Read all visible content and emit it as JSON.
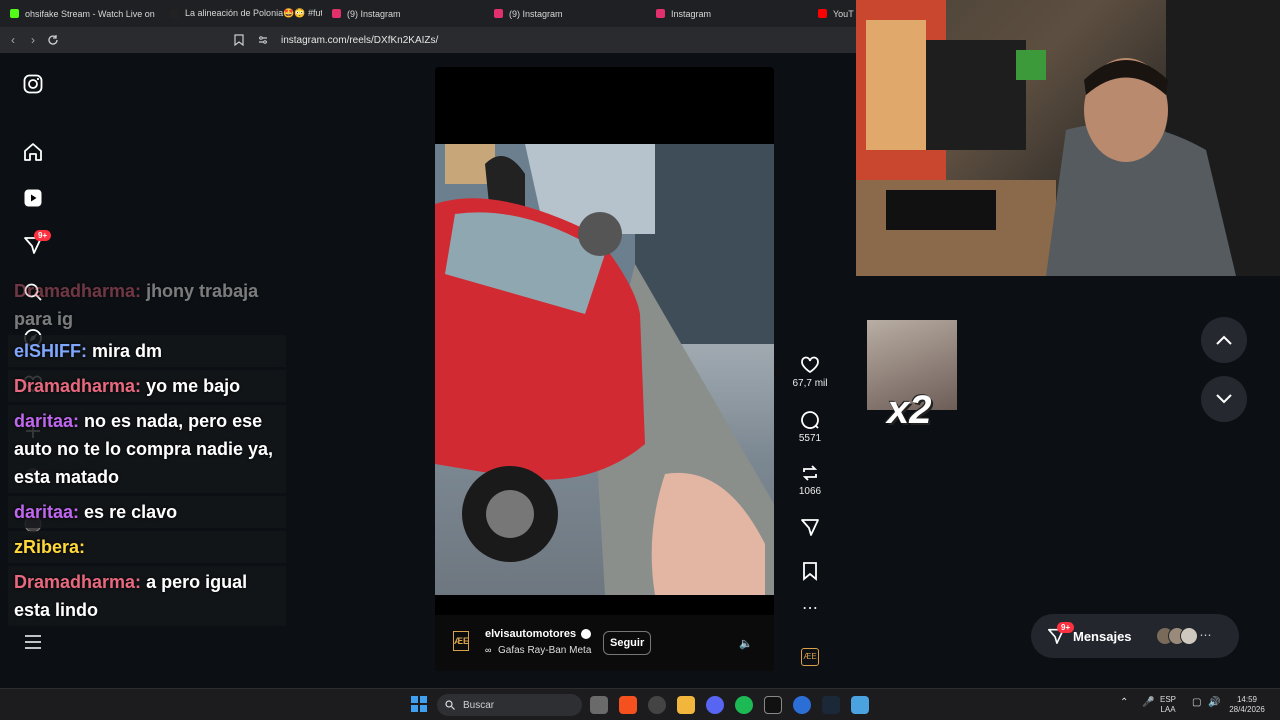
{
  "browser": {
    "tabs": [
      {
        "title": "ohsifake Stream - Watch Live on",
        "color": "#53fc18"
      },
      {
        "title": "La alineación de Polonia🤩😳 #futb",
        "color": "#222222"
      },
      {
        "title": "(9) Instagram",
        "color": "#e1306c"
      },
      {
        "title": "(9) Instagram",
        "color": "#e1306c"
      },
      {
        "title": "Instagram",
        "color": "#e1306c"
      },
      {
        "title": "YouT",
        "color": "#ff0000"
      }
    ],
    "url": "instagram.com/reels/DXfKn2KAIZs/"
  },
  "ig_sidebar": {
    "icons": [
      "instagram-logo-icon",
      "home-icon",
      "reels-icon",
      "messages-icon",
      "search-icon",
      "explore-icon",
      "heart-icon",
      "create-icon",
      "profile-icon",
      "more-icon"
    ],
    "notif_badge": "9+"
  },
  "chat": [
    {
      "user": "Dramadharma:",
      "text": "jhony trabaja para ig",
      "color": "#e8697f",
      "faded": true
    },
    {
      "user": "elSHIFF:",
      "text": "mira dm",
      "color": "#7fa7ff",
      "faded": false
    },
    {
      "user": "Dramadharma:",
      "text": "yo me bajo",
      "color": "#e8697f",
      "faded": false
    },
    {
      "user": "daritaa:",
      "text": "no es nada, pero ese auto no te lo compra nadie ya, esta matado",
      "color": "#c067f0",
      "faded": false
    },
    {
      "user": "daritaa:",
      "text": "es re clavo",
      "color": "#c067f0",
      "faded": false
    },
    {
      "user": "zRibera:",
      "text": "",
      "color": "#ffd93a",
      "faded": false
    },
    {
      "user": "Dramadharma:",
      "text": "a pero igual esta lindo",
      "color": "#e8697f",
      "faded": false
    }
  ],
  "reel": {
    "account": "elvisautomotores",
    "song": "Gafas Ray-Ban Meta",
    "follow_label": "Seguir",
    "likes": "67,7 mil",
    "comments": "5571",
    "reposts": "1066"
  },
  "overlay": {
    "emote_text": "x2"
  },
  "messages": {
    "label": "Mensajes",
    "badge": "9+"
  },
  "taskbar": {
    "search_placeholder": "Buscar",
    "lang_top": "ESP",
    "lang_bottom": "LAA",
    "time": "14:59",
    "date": "28/4/2026"
  }
}
